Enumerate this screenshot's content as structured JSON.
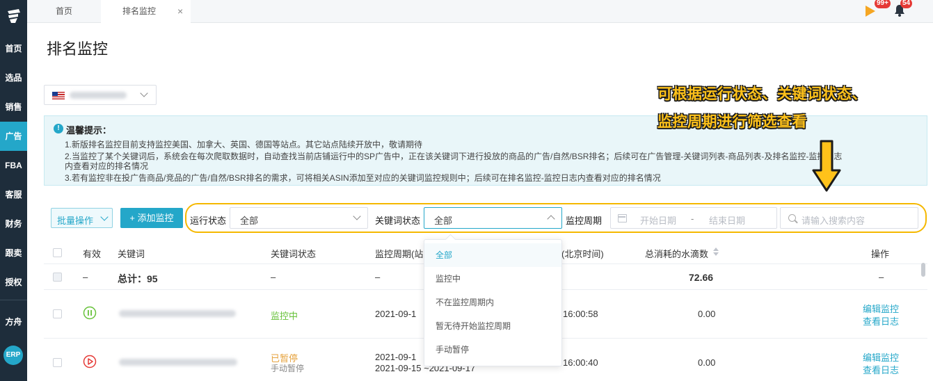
{
  "sidebar": {
    "items": [
      "首页",
      "选品",
      "销售",
      "广告",
      "FBA",
      "客服",
      "财务",
      "跟卖",
      "授权",
      "方舟"
    ],
    "active": "广告",
    "erp_label": "ERP"
  },
  "tabs": {
    "home": "首页",
    "active": "排名监控",
    "close": "×"
  },
  "topbar": {
    "flag_badge": "99+",
    "bell_badge": "54"
  },
  "page": {
    "title": "排名监控"
  },
  "notice": {
    "icon": "!",
    "title": "温馨提示：",
    "lines": [
      "1.新版排名监控目前支持监控美国、加拿大、英国、德国等站点。其它站点陆续开放中，敬请期待",
      "2.当监控了某个关键词后，系统会在每次爬取数据时，自动查找当前店铺运行中的SP广告中，正在该关键词下进行投放的商品的广告/自然/BSR排名；后续可在广告管理-关键词列表-商品列表-及排名监控-监控日志",
      "内查看对应的排名情况",
      "3.若有监控非在投广告商品/竞品的广告/自然/BSR排名的需求，可将相关ASIN添加至对应的关键词监控规则中；后续可在排名监控-监控日志内查看对应的排名情况"
    ]
  },
  "annotation": {
    "line1": "可根据运行状态、关键词状态、",
    "line2": "监控周期进行筛选查看"
  },
  "filters": {
    "batch_label": "批量操作",
    "add_label": "+ 添加监控",
    "run_status_label": "运行状态",
    "run_status_value": "全部",
    "kw_status_label": "关键词状态",
    "kw_status_value": "全部",
    "period_label": "监控周期",
    "date_start_placeholder": "开始日期",
    "date_separator": "-",
    "date_end_placeholder": "结束日期",
    "search_placeholder": "请输入搜索内容"
  },
  "dropdown": {
    "options": [
      "全部",
      "监控中",
      "不在监控周期内",
      "暂无待开始监控周期",
      "手动暂停"
    ],
    "selected": "全部"
  },
  "table": {
    "headers": {
      "valid": "有效",
      "keyword": "关键词",
      "kw_status": "关键词状态",
      "period": "监控周期(站",
      "time": "(北京时间)",
      "water": "总消耗的水滴数",
      "ops": "操作"
    },
    "total_row": {
      "valid": "–",
      "keyword": "总计：95",
      "kw_status": "–",
      "period": "–",
      "water": "72.66",
      "ops": "–"
    },
    "rows": [
      {
        "status_icon": "pause-icon",
        "kw_status": "监控中",
        "kw_status_sub": "",
        "period_line1": "2021-09-1",
        "period_line2": "",
        "time": "16:00:58",
        "water": "0.00",
        "edit": "编辑监控",
        "log": "查看日志"
      },
      {
        "status_icon": "play-icon",
        "kw_status": "已暂停",
        "kw_status_sub": "手动暂停",
        "period_line1": "2021-09-1",
        "period_line2": "2021-09-15 ~2021-09-17",
        "time": "16:00:40",
        "water": "0.00",
        "edit": "编辑监控",
        "log": "查看日志"
      }
    ]
  },
  "colors": {
    "accent": "#24a7c9",
    "sidebar": "#1e2d3b",
    "annotation": "#ffc21a",
    "paused": "#e6a23c",
    "running": "#67c23a",
    "play": "#e53935"
  }
}
